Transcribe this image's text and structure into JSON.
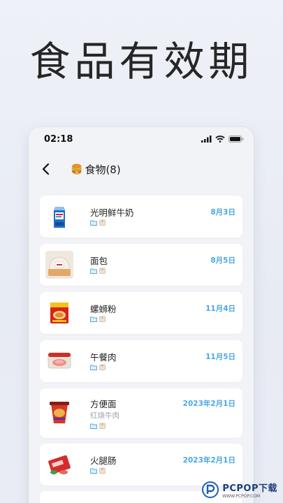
{
  "headline": "食品有效期",
  "status": {
    "time": "02:18"
  },
  "nav": {
    "title": "食物(8)",
    "title_emoji": "🍔"
  },
  "items": [
    {
      "name": "光明鲜牛奶",
      "date": "8月3日",
      "icon": "milk-carton-thumb"
    },
    {
      "name": "面包",
      "date": "8月5日",
      "icon": "bread-thumb"
    },
    {
      "name": "螺蛳粉",
      "date": "11月4日",
      "icon": "noodle-pack-thumb"
    },
    {
      "name": "午餐肉",
      "date": "11月5日",
      "icon": "luncheon-meat-thumb"
    },
    {
      "name": "方便面",
      "subtitle": "红烧牛肉",
      "date": "2023年2月1日",
      "icon": "instant-noodle-cup-thumb"
    },
    {
      "name": "火腿肠",
      "date": "2023年2月1日",
      "icon": "ham-sausage-thumb"
    }
  ],
  "watermark": {
    "text": "PCPOP下载",
    "sub": "WWW.PCPOP.COM"
  }
}
